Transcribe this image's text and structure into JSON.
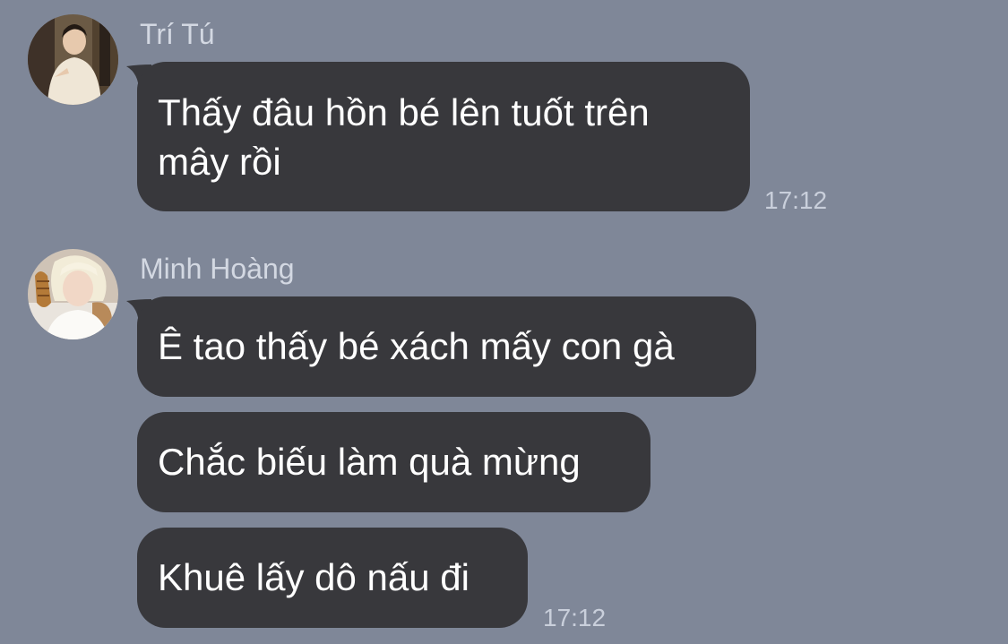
{
  "conversation": {
    "groups": [
      {
        "sender": "Trí Tú",
        "avatar_icon": "user-avatar-icon",
        "messages": [
          {
            "lines": [
              "Thấy đâu hồn bé lên tuốt trên",
              "mây rồi"
            ]
          }
        ],
        "time": "17:12"
      },
      {
        "sender": "Minh Hoàng",
        "avatar_icon": "user-avatar-icon",
        "messages": [
          {
            "lines": [
              "Ê tao thấy bé xách mấy con gà"
            ]
          },
          {
            "lines": [
              "Chắc biếu làm quà mừng"
            ]
          },
          {
            "lines": [
              "Khuê lấy dô nấu đi"
            ]
          }
        ],
        "time": "17:12"
      }
    ]
  },
  "colors": {
    "background": "#7f8798",
    "bubble": "#38383c",
    "bubble_text": "#ffffff",
    "sender_name": "#d3d8e2",
    "timestamp": "#c9cfdb"
  }
}
